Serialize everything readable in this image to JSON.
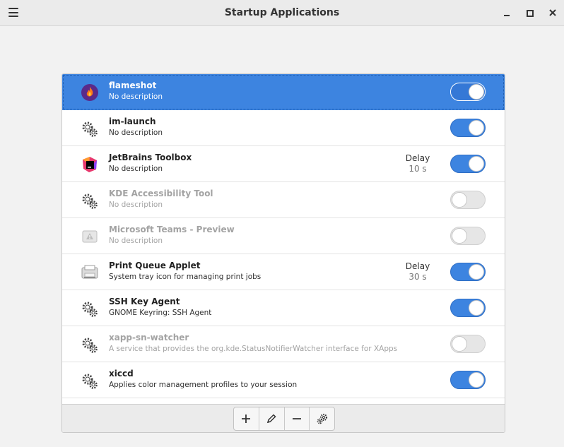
{
  "window": {
    "title": "Startup Applications"
  },
  "apps": [
    {
      "name": "flameshot",
      "description": "No description",
      "enabled": true,
      "selected": true,
      "icon": "flameshot-icon"
    },
    {
      "name": "im-launch",
      "description": "No description",
      "enabled": true,
      "icon": "gear-icon"
    },
    {
      "name": "JetBrains Toolbox",
      "description": "No description",
      "enabled": true,
      "delay_label": "Delay",
      "delay_value": "10 s",
      "icon": "jetbrains-toolbox-icon"
    },
    {
      "name": "KDE Accessibility Tool",
      "description": "No description",
      "enabled": false,
      "icon": "gear-icon"
    },
    {
      "name": "Microsoft Teams - Preview",
      "description": "No description",
      "enabled": false,
      "icon": "warning-icon"
    },
    {
      "name": "Print Queue Applet",
      "description": "System tray icon for managing print jobs",
      "enabled": true,
      "delay_label": "Delay",
      "delay_value": "30 s",
      "icon": "printer-icon"
    },
    {
      "name": "SSH Key Agent",
      "description": "GNOME Keyring: SSH Agent",
      "enabled": true,
      "icon": "gear-icon"
    },
    {
      "name": "xapp-sn-watcher",
      "description": "A service that provides the org.kde.StatusNotifierWatcher interface for XApps",
      "enabled": false,
      "icon": "gear-icon"
    },
    {
      "name": "xiccd",
      "description": "Applies color management profiles to your session",
      "enabled": true,
      "icon": "gear-icon"
    }
  ],
  "toolbar": {
    "add_icon": "plus-icon",
    "edit_icon": "pencil-icon",
    "remove_icon": "minus-icon",
    "settings_icon": "gear-icon"
  },
  "colors": {
    "accent": "#3d84e0",
    "window_bg": "#f2f2f2",
    "disabled_text": "#a3a3a3"
  }
}
